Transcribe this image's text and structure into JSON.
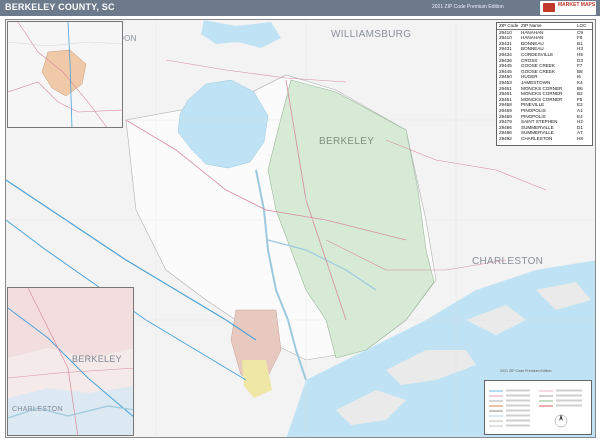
{
  "header": {
    "title": "BERKELEY COUNTY, SC",
    "edition": "2021 ZIP Code Premium Edition"
  },
  "logo": {
    "text": "MARKET MAPS"
  },
  "labels": {
    "williamsburg": "WILLIAMSBURG",
    "berkeley_main": "BERKELEY",
    "charleston_main": "CHARLESTON",
    "dorchester_partial": "NDON",
    "berkeley_inset": "BERKELEY",
    "charleston_inset": "CHARLESTON"
  },
  "zip_table": {
    "headers": [
      "ZIP Code",
      "ZIP Name",
      "LOC"
    ],
    "rows": [
      [
        "29410",
        "HANAHAN",
        "C9"
      ],
      [
        "29410",
        "HANAHAN",
        "F8"
      ],
      [
        "29431",
        "BONNEAU",
        "B1"
      ],
      [
        "29431",
        "BONNEAU",
        "H3"
      ],
      [
        "29434",
        "CORDESVILLE",
        "H5"
      ],
      [
        "29436",
        "CROSS",
        "D3"
      ],
      [
        "29445",
        "GOOSE CREEK",
        "F7"
      ],
      [
        "29445",
        "GOOSE CREEK",
        "B8"
      ],
      [
        "29450",
        "HUGER",
        "I6"
      ],
      [
        "29453",
        "JAMESTOWN",
        "K4"
      ],
      [
        "29461",
        "MONCKS CORNER",
        "B6"
      ],
      [
        "29461",
        "MONCKS CORNER",
        "B2"
      ],
      [
        "29461",
        "MONCKS CORNER",
        "F5"
      ],
      [
        "29468",
        "PINEVILLE",
        "E2"
      ],
      [
        "29469",
        "PINOPOLIS",
        "A1"
      ],
      [
        "29469",
        "PINOPOLIS",
        "E4"
      ],
      [
        "29479",
        "SAINT STEPHEN",
        "H2"
      ],
      [
        "29486",
        "SUMMERVILLE",
        "D1"
      ],
      [
        "29486",
        "SUMMERVILLE",
        "A7"
      ],
      [
        "29492",
        "CHARLESTON",
        "H8"
      ]
    ]
  },
  "legend": {
    "title": "2021 ZIP Code Premium Edition"
  },
  "colors": {
    "header_bg": "#6d7a8c",
    "water": "#bfe3f4",
    "county_focus": "#d8ecd8",
    "land": "#f4f4f4",
    "urban": "#e8c9c0",
    "roads": "#e6a0b0"
  }
}
